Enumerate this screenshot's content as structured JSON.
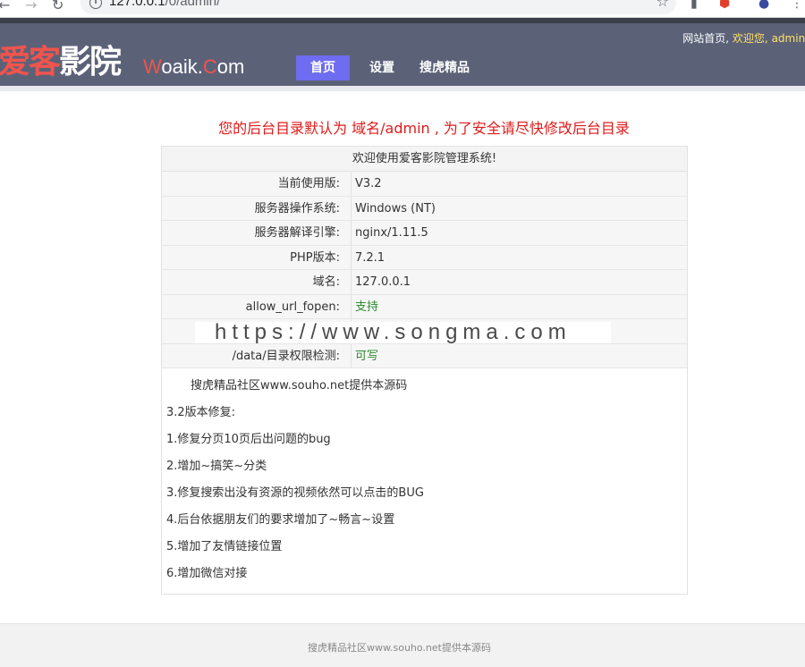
{
  "browser": {
    "url_host": "127.0.0.1",
    "url_path": "/0/admin/"
  },
  "header": {
    "logo_cn_red": "爱客",
    "logo_cn_white": "影院",
    "logo_en_w": "W",
    "logo_en_mid": "oaik.",
    "logo_en_c": "C",
    "logo_en_end": "om",
    "nav": [
      {
        "label": "首页",
        "active": true
      },
      {
        "label": "设置"
      },
      {
        "label": "搜虎精品"
      }
    ],
    "top_links": {
      "home": "网站首页,",
      "welcome": "欢迎您,",
      "user": "admin,"
    }
  },
  "notice": "您的后台目录默认为 域名/admin , 为了安全请尽快修改后台目录",
  "panel": {
    "title": "欢迎使用爱客影院管理系统!",
    "rows": [
      {
        "label": "当前使用版:",
        "value": "V3.2"
      },
      {
        "label": "服务器操作系统:",
        "value": "Windows (NT)"
      },
      {
        "label": "服务器解译引擎:",
        "value": "nginx/1.11.5"
      },
      {
        "label": "PHP版本:",
        "value": "7.2.1"
      },
      {
        "label": "域名:",
        "value": "127.0.0.1"
      },
      {
        "label": "allow_url_fopen:",
        "value": "支持"
      },
      {
        "label": "",
        "value": ""
      },
      {
        "label": "/data/目录权限检测:",
        "value": "可写"
      }
    ],
    "notes": [
      "搜虎精品社区www.souho.net提供本源码",
      "3.2版本修复:",
      "1.修复分页10页后出问题的bug",
      "2.增加~搞笑~分类",
      "3.修复搜索出没有资源的视频依然可以点击的BUG",
      "4.后台依据朋友们的要求增加了~畅言~设置",
      "5.增加了友情链接位置",
      "6.增加微信对接"
    ]
  },
  "watermark": "https://www.songma.com",
  "footer": "搜虎精品社区www.souho.net提供本源码"
}
